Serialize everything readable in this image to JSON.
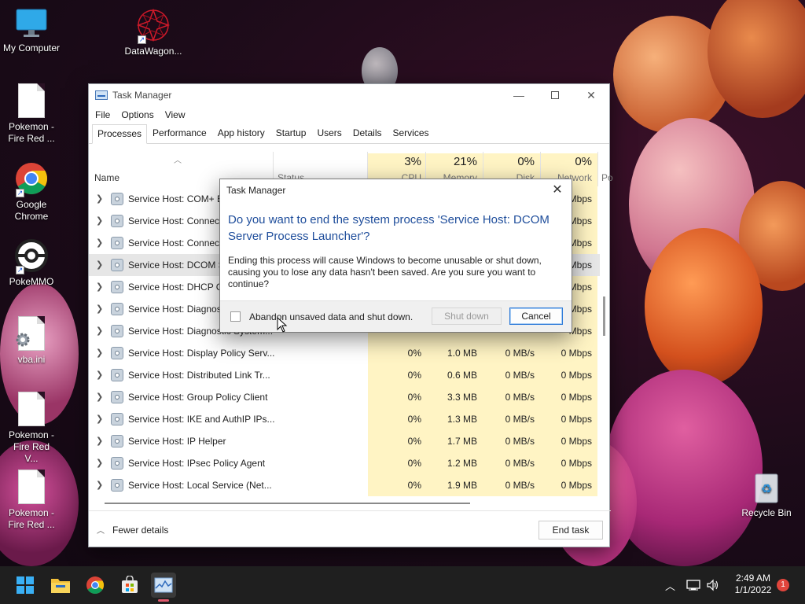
{
  "desktop": {
    "icons": [
      {
        "label": "My Computer"
      },
      {
        "label": "DataWagon..."
      },
      {
        "label": "Pokemon - Fire Red ..."
      },
      {
        "label": "Google Chrome"
      },
      {
        "label": "PokeMMO"
      },
      {
        "label": "vba.ini"
      },
      {
        "label": "Pokemon - Fire Red V..."
      },
      {
        "label": "Pokemon - Fire Red ..."
      },
      {
        "label": "Recycle Bin"
      }
    ]
  },
  "task_manager": {
    "title": "Task Manager",
    "menu": [
      "File",
      "Options",
      "View"
    ],
    "tabs": [
      "Processes",
      "Performance",
      "App history",
      "Startup",
      "Users",
      "Details",
      "Services"
    ],
    "active_tab": "Processes",
    "columns": {
      "name": "Name",
      "status": "Status",
      "cpu": {
        "pct": "3%",
        "label": "CPU"
      },
      "memory": {
        "pct": "21%",
        "label": "Memory"
      },
      "disk": {
        "pct": "0%",
        "label": "Disk"
      },
      "network": {
        "pct": "0%",
        "label": "Network"
      },
      "power": "Po"
    },
    "rows": [
      {
        "name": "Service Host: COM+ E",
        "cpu": "",
        "mem": "",
        "disk": "",
        "net": "Mbps"
      },
      {
        "name": "Service Host: Connect",
        "cpu": "",
        "mem": "",
        "disk": "",
        "net": "Mbps"
      },
      {
        "name": "Service Host: Connect",
        "cpu": "",
        "mem": "",
        "disk": "",
        "net": "Mbps"
      },
      {
        "name": "Service Host: DCOM S",
        "cpu": "",
        "mem": "",
        "disk": "",
        "net": "Mbps",
        "selected": true
      },
      {
        "name": "Service Host: DHCP Cl",
        "cpu": "",
        "mem": "",
        "disk": "",
        "net": "Mbps"
      },
      {
        "name": "Service Host: Diagnost",
        "cpu": "",
        "mem": "",
        "disk": "",
        "net": "Mbps"
      },
      {
        "name": "Service Host: Diagnostic System...",
        "cpu": "",
        "mem": "",
        "disk": "",
        "net": "Mbps"
      },
      {
        "name": "Service Host: Display Policy Serv...",
        "cpu": "0%",
        "mem": "1.0 MB",
        "disk": "0 MB/s",
        "net": "0 Mbps"
      },
      {
        "name": "Service Host: Distributed Link Tr...",
        "cpu": "0%",
        "mem": "0.6 MB",
        "disk": "0 MB/s",
        "net": "0 Mbps"
      },
      {
        "name": "Service Host: Group Policy Client",
        "cpu": "0%",
        "mem": "3.3 MB",
        "disk": "0 MB/s",
        "net": "0 Mbps"
      },
      {
        "name": "Service Host: IKE and AuthIP IPs...",
        "cpu": "0%",
        "mem": "1.3 MB",
        "disk": "0 MB/s",
        "net": "0 Mbps"
      },
      {
        "name": "Service Host: IP Helper",
        "cpu": "0%",
        "mem": "1.7 MB",
        "disk": "0 MB/s",
        "net": "0 Mbps"
      },
      {
        "name": "Service Host: IPsec Policy Agent",
        "cpu": "0%",
        "mem": "1.2 MB",
        "disk": "0 MB/s",
        "net": "0 Mbps"
      },
      {
        "name": "Service Host: Local Service (Net...",
        "cpu": "0%",
        "mem": "1.9 MB",
        "disk": "0 MB/s",
        "net": "0 Mbps"
      }
    ],
    "footer": {
      "fewer_details": "Fewer details",
      "end_task": "End task"
    }
  },
  "dialog": {
    "title": "Task Manager",
    "heading": "Do you want to end the system process 'Service Host: DCOM Server Process Launcher'?",
    "body": "Ending this process will cause Windows to become unusable or shut down, causing you to lose any data hasn't been saved. Are you sure you want to continue?",
    "checkbox_label": "Abandon unsaved data and shut down.",
    "checkbox_checked": false,
    "shutdown_label": "Shut down",
    "cancel_label": "Cancel"
  },
  "taskbar": {
    "apps": [
      "start-icon",
      "file-explorer-icon",
      "chrome-icon",
      "store-icon",
      "task-manager-icon"
    ],
    "time": "2:49 AM",
    "date": "1/1/2022",
    "notification_count": "1"
  },
  "colors": {
    "heading_blue": "#1e4d9b",
    "yellow_highlight": "#fff4c4",
    "taskbar": "#1f1f1f",
    "notification": "#e0453c"
  }
}
